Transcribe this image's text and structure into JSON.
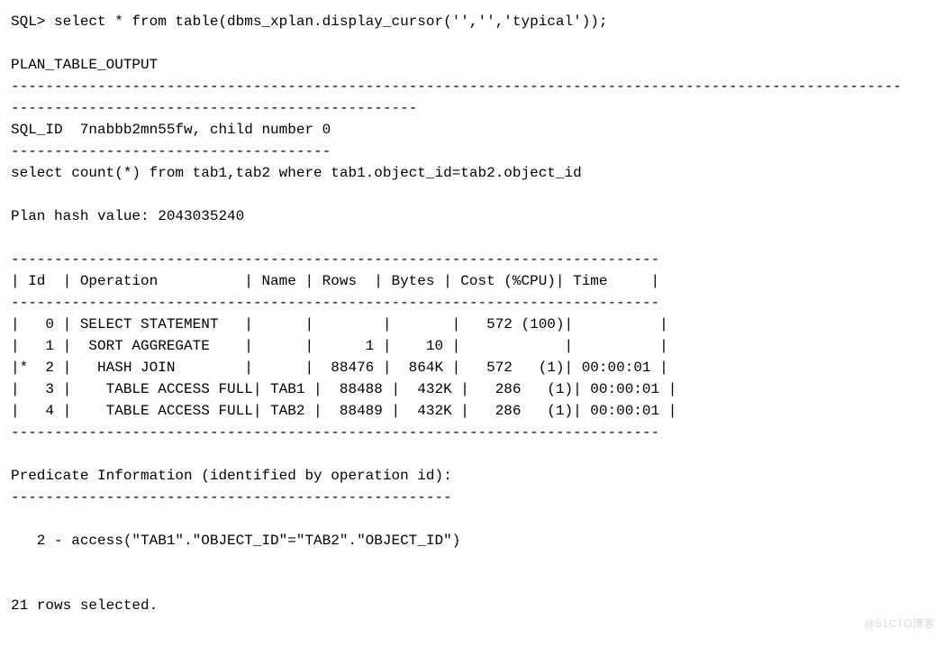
{
  "prompt": "SQL> ",
  "command": "select * from table(dbms_xplan.display_cursor('','','typical'));",
  "heading": "PLAN_TABLE_OUTPUT",
  "sql_id_line": "SQL_ID  7nabbb2mn55fw, child number 0",
  "query_echo": "select count(*) from tab1,tab2 where tab1.object_id=tab2.object_id",
  "plan_hash_line": "Plan hash value: 2043035240",
  "plan_header": "| Id  | Operation          | Name | Rows  | Bytes | Cost (%CPU)| Time     |",
  "plan_rows": [
    {
      "id": "0",
      "marker": " ",
      "operation": "SELECT STATEMENT",
      "name": "",
      "rows": "",
      "bytes": "",
      "cost": "572",
      "cpu": "(100)",
      "time": ""
    },
    {
      "id": "1",
      "marker": " ",
      "operation": " SORT AGGREGATE",
      "name": "",
      "rows": "1",
      "bytes": "10",
      "cost": "",
      "cpu": "",
      "time": ""
    },
    {
      "id": "2",
      "marker": "*",
      "operation": "  HASH JOIN",
      "name": "",
      "rows": "88476",
      "bytes": "864K",
      "cost": "572",
      "cpu": "(1)",
      "time": "00:00:01"
    },
    {
      "id": "3",
      "marker": " ",
      "operation": "   TABLE ACCESS FULL",
      "name": "TAB1",
      "rows": "88488",
      "bytes": "432K",
      "cost": "286",
      "cpu": "(1)",
      "time": "00:00:01"
    },
    {
      "id": "4",
      "marker": " ",
      "operation": "   TABLE ACCESS FULL",
      "name": "TAB2",
      "rows": "88489",
      "bytes": "432K",
      "cost": "286",
      "cpu": "(1)",
      "time": "00:00:01"
    }
  ],
  "predicate_header": "Predicate Information (identified by operation id):",
  "predicate_line": "   2 - access(\"TAB1\".\"OBJECT_ID\"=\"TAB2\".\"OBJECT_ID\")",
  "rows_selected": "21 rows selected.",
  "watermark": "@51CTO博客",
  "chart_data": {
    "type": "table",
    "title": "Oracle Execution Plan (dbms_xplan.display_cursor)",
    "sql_id": "7nabbb2mn55fw",
    "child_number": 0,
    "plan_hash_value": 2043035240,
    "query": "select count(*) from tab1,tab2 where tab1.object_id=tab2.object_id",
    "columns": [
      "Id",
      "Operation",
      "Name",
      "Rows",
      "Bytes",
      "Cost (%CPU)",
      "Time"
    ],
    "rows": [
      [
        0,
        "SELECT STATEMENT",
        "",
        null,
        null,
        "572 (100)",
        null
      ],
      [
        1,
        "SORT AGGREGATE",
        "",
        1,
        "10",
        null,
        null
      ],
      [
        2,
        "HASH JOIN",
        "",
        88476,
        "864K",
        "572 (1)",
        "00:00:01"
      ],
      [
        3,
        "TABLE ACCESS FULL",
        "TAB1",
        88488,
        "432K",
        "286 (1)",
        "00:00:01"
      ],
      [
        4,
        "TABLE ACCESS FULL",
        "TAB2",
        88489,
        "432K",
        "286 (1)",
        "00:00:01"
      ]
    ],
    "predicates": [
      {
        "id": 2,
        "type": "access",
        "condition": "\"TAB1\".\"OBJECT_ID\"=\"TAB2\".\"OBJECT_ID\""
      }
    ]
  }
}
